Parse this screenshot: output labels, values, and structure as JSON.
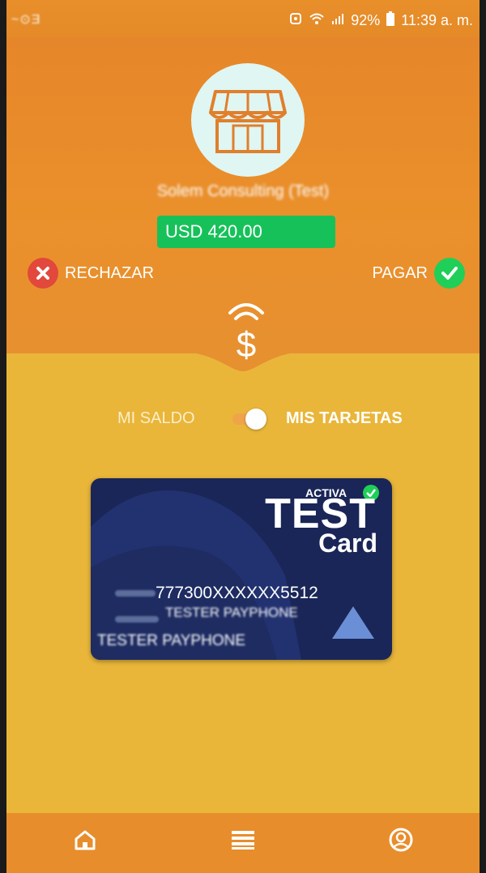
{
  "status_bar": {
    "left_icons_text": "~⊙Ǝ",
    "battery": "92%",
    "time": "11:39 a. m."
  },
  "header": {
    "merchant_name": "Solem Consulting (Test)",
    "amount": "USD 420.00",
    "reject_label": "RECHAZAR",
    "pay_label": "PAGAR"
  },
  "toggle": {
    "left_label": "MI SALDO",
    "right_label": "MIS TARJETAS",
    "selected": "MIS TARJETAS"
  },
  "card": {
    "status": "ACTIVA",
    "brand_line1": "TEST",
    "brand_line2": "Card",
    "number": "777300XXXXXX5512",
    "holder_line1": "TESTER PAYPHONE",
    "holder_line2": "TESTER PAYPHONE"
  },
  "bottom_nav": {
    "items": [
      "home-icon",
      "list-icon",
      "profile-icon"
    ]
  },
  "colors": {
    "header_orange": "#e6862a",
    "body_yellow": "#e9b63a",
    "amount_green": "#17c15a",
    "reject_red": "#e2483b",
    "pay_green": "#1fcf58",
    "card_navy": "#1a2657"
  }
}
